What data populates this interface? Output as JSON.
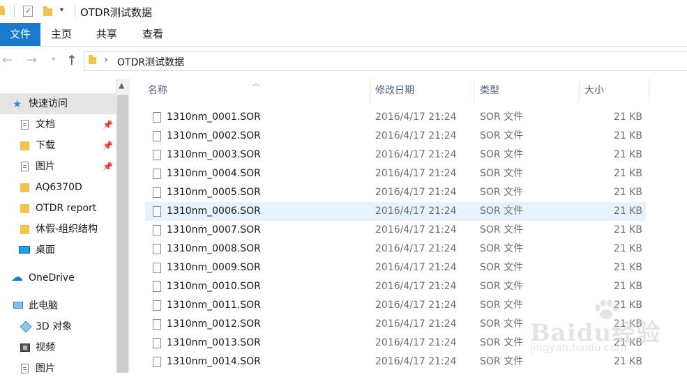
{
  "window": {
    "title": "OTDR测试数据",
    "quick_access_dropdown": "▾"
  },
  "ribbon": {
    "tabs": {
      "file": "文件",
      "home": "主页",
      "share": "共享",
      "view": "查看"
    }
  },
  "nav": {
    "back": "←",
    "forward": "→",
    "recent": "▾",
    "up": "↑",
    "address": {
      "chevron": "›",
      "path": "OTDR测试数据"
    }
  },
  "sidebar": {
    "quick_access": "快速访问",
    "items": [
      {
        "label": "文档",
        "pinned": true,
        "icon": "document-icon"
      },
      {
        "label": "下载",
        "pinned": true,
        "icon": "download-folder-icon"
      },
      {
        "label": "图片",
        "pinned": true,
        "icon": "pictures-icon"
      },
      {
        "label": "AQ6370D",
        "pinned": false,
        "icon": "folder-icon"
      },
      {
        "label": "OTDR report",
        "pinned": false,
        "icon": "folder-icon"
      },
      {
        "label": "休假-组织结构",
        "pinned": false,
        "icon": "folder-icon"
      },
      {
        "label": "桌面",
        "pinned": false,
        "icon": "desktop-icon"
      }
    ],
    "onedrive": "OneDrive",
    "this_pc": "此电脑",
    "pc_items": [
      {
        "label": "3D 对象",
        "icon": "3d-objects-icon"
      },
      {
        "label": "视频",
        "icon": "video-icon"
      },
      {
        "label": "图片",
        "icon": "pictures-icon"
      }
    ],
    "pin_glyph": "📌"
  },
  "filelist": {
    "columns": {
      "name": "名称",
      "date": "修改日期",
      "type": "类型",
      "size": "大小"
    },
    "sort_indicator": "︿",
    "highlighted_index": 5,
    "files": [
      {
        "name": "1310nm_0001.SOR",
        "date": "2016/4/17 21:24",
        "type": "SOR 文件",
        "size": "21 KB"
      },
      {
        "name": "1310nm_0002.SOR",
        "date": "2016/4/17 21:24",
        "type": "SOR 文件",
        "size": "21 KB"
      },
      {
        "name": "1310nm_0003.SOR",
        "date": "2016/4/17 21:24",
        "type": "SOR 文件",
        "size": "21 KB"
      },
      {
        "name": "1310nm_0004.SOR",
        "date": "2016/4/17 21:24",
        "type": "SOR 文件",
        "size": "21 KB"
      },
      {
        "name": "1310nm_0005.SOR",
        "date": "2016/4/17 21:24",
        "type": "SOR 文件",
        "size": "21 KB"
      },
      {
        "name": "1310nm_0006.SOR",
        "date": "2016/4/17 21:24",
        "type": "SOR 文件",
        "size": "21 KB"
      },
      {
        "name": "1310nm_0007.SOR",
        "date": "2016/4/17 21:24",
        "type": "SOR 文件",
        "size": "21 KB"
      },
      {
        "name": "1310nm_0008.SOR",
        "date": "2016/4/17 21:24",
        "type": "SOR 文件",
        "size": "21 KB"
      },
      {
        "name": "1310nm_0009.SOR",
        "date": "2016/4/17 21:24",
        "type": "SOR 文件",
        "size": "21 KB"
      },
      {
        "name": "1310nm_0010.SOR",
        "date": "2016/4/17 21:24",
        "type": "SOR 文件",
        "size": "21 KB"
      },
      {
        "name": "1310nm_0011.SOR",
        "date": "2016/4/17 21:24",
        "type": "SOR 文件",
        "size": "21 KB"
      },
      {
        "name": "1310nm_0012.SOR",
        "date": "2016/4/17 21:24",
        "type": "SOR 文件",
        "size": "21 KB"
      },
      {
        "name": "1310nm_0013.SOR",
        "date": "2016/4/17 21:24",
        "type": "SOR 文件",
        "size": "21 KB"
      },
      {
        "name": "1310nm_0014.SOR",
        "date": "2016/4/17 21:24",
        "type": "SOR 文件",
        "size": "21 KB"
      }
    ]
  },
  "watermark": {
    "text": "Baidu经验",
    "url": "jingyan.baidu.com"
  },
  "colors": {
    "accent": "#1979ca",
    "folder": "#f1c24d",
    "row_highlight": "#e5f3ff",
    "nav_selected": "#e5e5e5",
    "header_text": "#4c607a"
  }
}
